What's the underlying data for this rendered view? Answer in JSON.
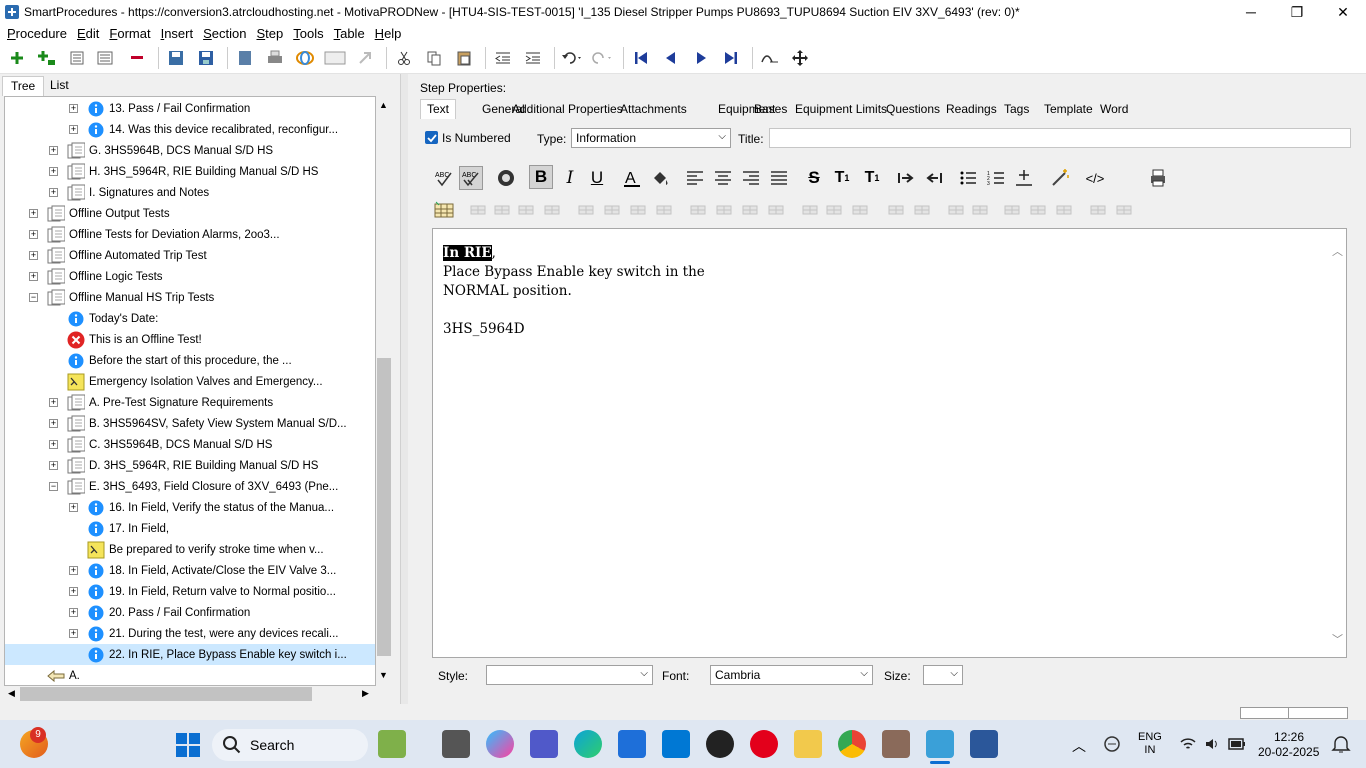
{
  "titlebar": {
    "title": "SmartProcedures - https://conversion3.atrcloudhosting.net - MotivaPRODNew - [HTU4-SIS-TEST-0015] 'I_135 Diesel Stripper Pumps PU8693_TUPU8694 Suction EIV 3XV_6493' (rev: 0)*",
    "minimize": "─",
    "restore": "❐",
    "close": "✕"
  },
  "menubar": {
    "items": [
      "Procedure",
      "Edit",
      "Format",
      "Insert",
      "Section",
      "Step",
      "Tools",
      "Table",
      "Help"
    ]
  },
  "left_tabs": {
    "tree": "Tree",
    "list": "List"
  },
  "tree": {
    "nodes": [
      {
        "label": "13. Pass / Fail Confirmation",
        "icon": "info-icon",
        "level": 3,
        "expander": "+"
      },
      {
        "label": "14. Was this device recalibrated, reconfigur...",
        "icon": "info-icon",
        "level": 3,
        "expander": "+"
      },
      {
        "label": "G. 3HS5964B, DCS Manual S/D HS",
        "icon": "section-icon",
        "level": 2,
        "expander": "+"
      },
      {
        "label": "H. 3HS_5964R, RIE Building Manual S/D HS",
        "icon": "section-icon",
        "level": 2,
        "expander": "+"
      },
      {
        "label": "I. Signatures and Notes",
        "icon": "section-icon",
        "level": 2,
        "expander": "+"
      },
      {
        "label": "Offline Output Tests",
        "icon": "section-icon",
        "level": 1,
        "expander": "+"
      },
      {
        "label": "Offline Tests for Deviation Alarms, 2oo3...",
        "icon": "section-icon",
        "level": 1,
        "expander": "+"
      },
      {
        "label": "Offline Automated Trip Test",
        "icon": "section-icon",
        "level": 1,
        "expander": "+"
      },
      {
        "label": "Offline Logic Tests",
        "icon": "section-icon",
        "level": 1,
        "expander": "+"
      },
      {
        "label": "Offline Manual HS Trip Tests",
        "icon": "section-icon",
        "level": 1,
        "expander": "−"
      },
      {
        "label": "Today's Date:",
        "icon": "info-icon",
        "level": 2,
        "expander": ""
      },
      {
        "label": "This is an Offline Test!",
        "icon": "error-icon",
        "level": 2,
        "expander": ""
      },
      {
        "label": "Before the start of this procedure, the ...",
        "icon": "info-icon",
        "level": 2,
        "expander": ""
      },
      {
        "label": "Emergency Isolation Valves and Emergency...",
        "icon": "note-icon",
        "level": 2,
        "expander": ""
      },
      {
        "label": "A. Pre-Test Signature Requirements",
        "icon": "section-icon",
        "level": 2,
        "expander": "+"
      },
      {
        "label": "B. 3HS5964SV, Safety View System Manual S/D...",
        "icon": "section-icon",
        "level": 2,
        "expander": "+"
      },
      {
        "label": "C. 3HS5964B, DCS Manual S/D HS",
        "icon": "section-icon",
        "level": 2,
        "expander": "+"
      },
      {
        "label": "D. 3HS_5964R, RIE Building Manual S/D HS",
        "icon": "section-icon",
        "level": 2,
        "expander": "+"
      },
      {
        "label": "E. 3HS_6493, Field Closure of 3XV_6493 (Pne...",
        "icon": "section-icon",
        "level": 2,
        "expander": "−"
      },
      {
        "label": "16. In Field, Verify the status of the Manua...",
        "icon": "info-icon",
        "level": 3,
        "expander": "+"
      },
      {
        "label": "17. In Field,",
        "icon": "info-icon",
        "level": 3,
        "expander": ""
      },
      {
        "label": "Be prepared to verify stroke time when v...",
        "icon": "note-icon",
        "level": 3,
        "expander": ""
      },
      {
        "label": "18. In Field, Activate/Close the EIV Valve 3...",
        "icon": "info-icon",
        "level": 3,
        "expander": "+"
      },
      {
        "label": "19. In Field, Return valve to Normal positio...",
        "icon": "info-icon",
        "level": 3,
        "expander": "+"
      },
      {
        "label": "20. Pass / Fail Confirmation",
        "icon": "info-icon",
        "level": 3,
        "expander": "+"
      },
      {
        "label": "21. During the test, were any devices recali...",
        "icon": "info-icon",
        "level": 3,
        "expander": "+"
      },
      {
        "label": "22. In RIE, Place Bypass Enable key switch i...",
        "icon": "info-icon",
        "level": 3,
        "expander": "",
        "selected": true
      },
      {
        "label": "A.",
        "icon": "pointer-icon",
        "level": 1,
        "expander": ""
      }
    ]
  },
  "right": {
    "header": "Step Properties:",
    "tabs": [
      "Text",
      "General",
      "Additional Properties",
      "Attachments",
      "Equipment",
      "Bases",
      "Equipment Limits",
      "Questions",
      "Readings",
      "Tags",
      "Template",
      "Word"
    ],
    "is_numbered_label": "Is Numbered",
    "type_label": "Type:",
    "type_value": "Information",
    "title_label": "Title:",
    "title_value": "",
    "editor": {
      "line1_highlight": "In RIE",
      "line1_rest": ",",
      "line2": "Place Bypass Enable key switch in the",
      "line3": "NORMAL position.",
      "line4": "3HS_5964D"
    },
    "style_label": "Style:",
    "style_value": "",
    "font_label": "Font:",
    "font_value": "Cambria",
    "size_label": "Size:",
    "size_value": ""
  },
  "taskbar": {
    "search_label": "Search",
    "badge": "9",
    "lang1": "ENG",
    "lang2": "IN",
    "time": "12:26",
    "date": "20-02-2025"
  },
  "colors": {
    "selection": "#cce8ff",
    "info_blue": "#1e90ff",
    "error_red": "#e02424",
    "taskbar": "#dfe7f2"
  }
}
